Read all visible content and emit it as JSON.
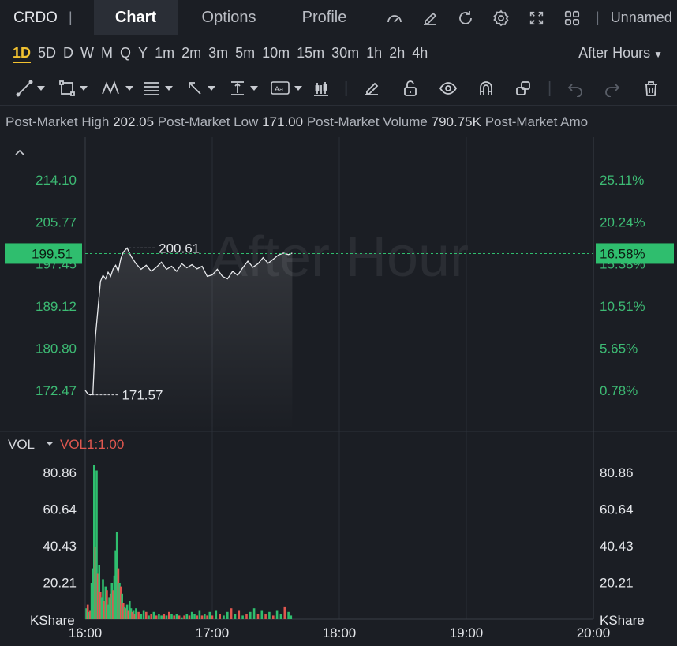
{
  "header": {
    "ticker": "CRDO",
    "tabs": {
      "chart": "Chart",
      "options": "Options",
      "profile": "Profile"
    },
    "layout_name": "Unnamed"
  },
  "periods": [
    "1D",
    "5D",
    "D",
    "W",
    "M",
    "Q",
    "Y",
    "1m",
    "2m",
    "3m",
    "5m",
    "10m",
    "15m",
    "30m",
    "1h",
    "2h",
    "4h"
  ],
  "active_period": "1D",
  "session": "After Hours",
  "info": {
    "high_label": "Post-Market High",
    "high": "202.05",
    "low_label": "Post-Market Low",
    "low": "171.00",
    "volume_label": "Post-Market Volume",
    "volume": "790.75K",
    "amount_label": "Post-Market Amo"
  },
  "colors": {
    "up": "#2fbe6e",
    "down": "#e0574f",
    "accent": "#f2c230",
    "badge": "#2fbe6e"
  },
  "chart_data": {
    "type": "line",
    "watermark": "After Hour",
    "x_ticks": [
      "16:00",
      "17:00",
      "18:00",
      "19:00",
      "20:00"
    ],
    "y_ticks": [
      "214.10",
      "205.77",
      "197.45",
      "189.12",
      "180.80",
      "172.47"
    ],
    "y_tick_values": [
      214.1,
      205.77,
      197.45,
      189.12,
      180.8,
      172.47
    ],
    "pct_ticks": [
      "25.11%",
      "20.24%",
      "15.38%",
      "10.51%",
      "5.65%",
      "0.78%"
    ],
    "ylim": [
      164.5,
      222.5
    ],
    "current_price": "199.51",
    "current_price_value": 199.51,
    "current_pct": "16.58%",
    "max_label": "200.61",
    "min_label": "171.57",
    "max_point": {
      "t": 0.33,
      "v": 200.61
    },
    "min_point": {
      "t": 0.04,
      "v": 171.57
    },
    "series": [
      {
        "t": [
          0.0,
          0.02,
          0.04,
          0.06,
          0.08,
          0.1,
          0.12,
          0.14,
          0.16,
          0.18,
          0.2,
          0.22,
          0.24,
          0.26,
          0.28,
          0.3,
          0.33,
          0.36,
          0.4,
          0.44,
          0.48,
          0.52,
          0.56,
          0.6,
          0.64,
          0.68,
          0.72,
          0.76,
          0.8,
          0.84,
          0.88,
          0.92,
          0.96,
          1.0,
          1.04,
          1.08,
          1.12,
          1.16,
          1.2,
          1.24,
          1.28,
          1.32,
          1.36,
          1.4,
          1.44,
          1.48,
          1.52,
          1.56,
          1.6,
          1.63
        ],
        "v": [
          172.47,
          171.8,
          171.57,
          171.7,
          183.0,
          188.5,
          194.0,
          195.2,
          194.5,
          195.8,
          195.0,
          196.5,
          197.2,
          196.0,
          198.5,
          199.8,
          200.61,
          199.0,
          197.5,
          196.4,
          197.2,
          196.0,
          196.8,
          197.8,
          196.4,
          197.0,
          196.0,
          197.5,
          196.7,
          197.3,
          196.5,
          197.0,
          195.0,
          195.3,
          196.4,
          195.0,
          194.5,
          196.0,
          195.2,
          196.7,
          198.0,
          196.8,
          197.5,
          198.7,
          197.6,
          198.4,
          199.2,
          199.6,
          199.3,
          199.6
        ]
      }
    ],
    "volume": {
      "label": "VOL",
      "indicator": "VOL1:1.00",
      "unit_label": "KShare",
      "y_ticks": [
        "80.86",
        "60.64",
        "40.43",
        "20.21"
      ],
      "y_tick_values": [
        80.86,
        60.64,
        40.43,
        20.21
      ],
      "ylim": [
        0,
        97
      ],
      "t": [
        0.01,
        0.02,
        0.03,
        0.04,
        0.05,
        0.06,
        0.07,
        0.08,
        0.09,
        0.1,
        0.11,
        0.12,
        0.13,
        0.14,
        0.15,
        0.16,
        0.17,
        0.18,
        0.19,
        0.2,
        0.21,
        0.22,
        0.23,
        0.24,
        0.25,
        0.26,
        0.27,
        0.28,
        0.29,
        0.3,
        0.31,
        0.32,
        0.33,
        0.34,
        0.35,
        0.36,
        0.37,
        0.38,
        0.39,
        0.4,
        0.42,
        0.44,
        0.46,
        0.48,
        0.5,
        0.52,
        0.54,
        0.56,
        0.58,
        0.6,
        0.62,
        0.64,
        0.66,
        0.68,
        0.7,
        0.72,
        0.74,
        0.76,
        0.78,
        0.8,
        0.82,
        0.84,
        0.86,
        0.88,
        0.9,
        0.92,
        0.94,
        0.96,
        0.98,
        1.0,
        1.03,
        1.06,
        1.09,
        1.12,
        1.15,
        1.18,
        1.21,
        1.24,
        1.27,
        1.3,
        1.33,
        1.36,
        1.39,
        1.42,
        1.45,
        1.48,
        1.51,
        1.54,
        1.57,
        1.6,
        1.62
      ],
      "v": [
        6,
        8,
        4,
        5,
        20,
        28,
        85,
        40,
        82,
        25,
        30,
        15,
        12,
        22,
        10,
        18,
        16,
        8,
        12,
        14,
        20,
        16,
        24,
        38,
        48,
        28,
        20,
        18,
        14,
        9,
        7,
        6,
        8,
        5,
        10,
        6,
        4,
        5,
        3,
        6,
        4,
        3,
        5,
        4,
        2,
        3,
        4,
        2,
        3,
        2,
        3,
        2,
        4,
        3,
        2,
        3,
        2,
        1,
        2,
        3,
        2,
        4,
        3,
        2,
        5,
        2,
        3,
        2,
        4,
        2,
        5,
        3,
        2,
        4,
        6,
        3,
        5,
        2,
        3,
        4,
        6,
        3,
        5,
        3,
        4,
        2,
        5,
        3,
        7,
        4,
        2
      ],
      "dir": [
        1,
        0,
        1,
        0,
        1,
        1,
        1,
        0,
        1,
        0,
        1,
        0,
        1,
        1,
        0,
        1,
        0,
        1,
        1,
        0,
        1,
        0,
        1,
        1,
        1,
        0,
        1,
        0,
        1,
        0,
        1,
        0,
        1,
        0,
        1,
        1,
        0,
        1,
        0,
        1,
        0,
        1,
        1,
        0,
        1,
        0,
        1,
        0,
        1,
        1,
        0,
        1,
        0,
        1,
        0,
        1,
        0,
        1,
        0,
        1,
        0,
        1,
        1,
        0,
        1,
        0,
        1,
        0,
        1,
        0,
        1,
        0,
        1,
        1,
        0,
        1,
        0,
        1,
        0,
        1,
        1,
        0,
        1,
        0,
        1,
        0,
        1,
        1,
        0,
        1,
        1
      ]
    }
  }
}
